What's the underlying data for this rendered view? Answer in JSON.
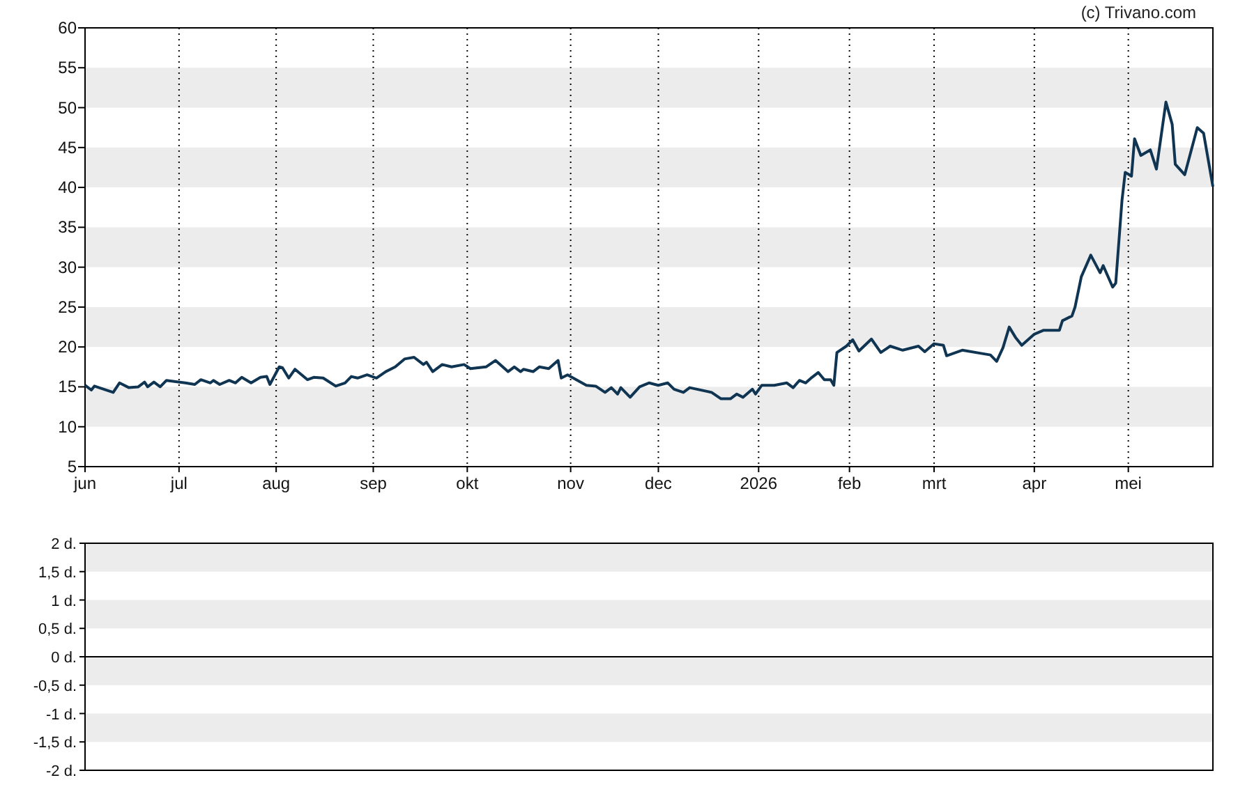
{
  "credit": "(c) Trivano.com",
  "price_chart": {
    "chart_data": {
      "type": "line",
      "ylim": [
        5,
        60
      ],
      "yticks": [
        5,
        10,
        15,
        20,
        25,
        30,
        35,
        40,
        45,
        50,
        55,
        60
      ],
      "categories": [
        "jun",
        null,
        null,
        null,
        null,
        null,
        null,
        null,
        null,
        null,
        null,
        null,
        null,
        null,
        null,
        null,
        null,
        null,
        null,
        null,
        null,
        null,
        null,
        null,
        null,
        null,
        null,
        null,
        null,
        null,
        "jul",
        null,
        null,
        null,
        null,
        null,
        null,
        null,
        null,
        null,
        null,
        null,
        null,
        null,
        null,
        null,
        null,
        null,
        null,
        null,
        null,
        null,
        null,
        null,
        null,
        null,
        null,
        null,
        null,
        null,
        null,
        "aug",
        null,
        null,
        null,
        null,
        null,
        null,
        null,
        null,
        null,
        null,
        null,
        null,
        null,
        null,
        null,
        null,
        null,
        null,
        null,
        null,
        null,
        null,
        null,
        null,
        null,
        null,
        null,
        null,
        null,
        null,
        "sep",
        null,
        null,
        null,
        null,
        null,
        null,
        null,
        null,
        null,
        null,
        null,
        null,
        null,
        null,
        null,
        null,
        null,
        null,
        null,
        null,
        null,
        null,
        null,
        null,
        null,
        null,
        null,
        null,
        null,
        "okt",
        null,
        null,
        null,
        null,
        null,
        null,
        null,
        null,
        null,
        null,
        null,
        null,
        null,
        null,
        null,
        null,
        null,
        null,
        null,
        null,
        null,
        null,
        null,
        null,
        null,
        null,
        null,
        null,
        null,
        null,
        null,
        null,
        "nov",
        null,
        null,
        null,
        null,
        null,
        null,
        null,
        null,
        null,
        null,
        null,
        null,
        null,
        null,
        null,
        null,
        null,
        null,
        null,
        null,
        null,
        null,
        null,
        null,
        null,
        null,
        null,
        "dec",
        null,
        null,
        null,
        null,
        null,
        null,
        null,
        null,
        null,
        null,
        null,
        null,
        null,
        null,
        null,
        null,
        null,
        null,
        null,
        null,
        null,
        null,
        null,
        null,
        null,
        null,
        null,
        null,
        null,
        null,
        null,
        "2026",
        null,
        null,
        null,
        null,
        null,
        null,
        null,
        null,
        null,
        null,
        null,
        null,
        null,
        null,
        null,
        null,
        null,
        null,
        null,
        null,
        null,
        null,
        null,
        null,
        null,
        null,
        null,
        null,
        "feb",
        null,
        null,
        null,
        null,
        null,
        null,
        null,
        null,
        null,
        null,
        null,
        null,
        null,
        null,
        null,
        null,
        null,
        null,
        null,
        null,
        null,
        null,
        null,
        null,
        null,
        null,
        "mrt",
        null,
        null,
        null,
        null,
        null,
        null,
        null,
        null,
        null,
        null,
        null,
        null,
        null,
        null,
        null,
        null,
        null,
        null,
        null,
        null,
        null,
        null,
        null,
        null,
        null,
        null,
        null,
        null,
        null,
        null,
        null,
        "apr",
        null,
        null,
        null,
        null,
        null,
        null,
        null,
        null,
        null,
        null,
        null,
        null,
        null,
        null,
        null,
        null,
        null,
        null,
        null,
        null,
        null,
        null,
        null,
        null,
        null,
        null,
        null,
        null,
        null,
        "mei",
        null,
        null,
        null,
        null,
        null,
        null,
        null,
        null,
        null,
        null,
        null,
        null,
        null,
        null,
        null,
        null,
        null,
        null,
        null,
        null,
        null,
        null,
        null,
        null,
        null,
        null,
        null
      ],
      "series": [
        {
          "color": "#0f3553",
          "values": [
            15.2,
            null,
            14.6,
            15.1,
            null,
            null,
            null,
            null,
            null,
            14.3,
            null,
            15.5,
            null,
            null,
            14.9,
            null,
            null,
            15.0,
            null,
            15.6,
            15.0,
            null,
            15.6,
            null,
            15.0,
            null,
            15.8,
            null,
            null,
            null,
            null,
            null,
            15.5,
            null,
            null,
            15.3,
            null,
            15.9,
            null,
            null,
            15.5,
            15.8,
            null,
            15.3,
            null,
            null,
            15.8,
            null,
            15.5,
            null,
            16.2,
            null,
            null,
            15.5,
            null,
            null,
            16.2,
            null,
            16.3,
            15.3,
            null,
            null,
            17.5,
            17.4,
            null,
            16.1,
            null,
            17.2,
            null,
            null,
            null,
            15.9,
            null,
            16.2,
            null,
            null,
            16.1,
            null,
            null,
            null,
            15.1,
            null,
            null,
            15.5,
            null,
            16.3,
            null,
            16.1,
            null,
            null,
            16.5,
            null,
            null,
            16.1,
            null,
            null,
            16.9,
            null,
            null,
            17.5,
            null,
            null,
            18.5,
            null,
            null,
            18.7,
            null,
            null,
            17.8,
            18.1,
            null,
            16.9,
            null,
            null,
            17.8,
            null,
            null,
            17.5,
            null,
            null,
            null,
            17.8,
            null,
            17.3,
            null,
            null,
            null,
            null,
            17.5,
            null,
            null,
            18.3,
            null,
            null,
            null,
            16.9,
            null,
            17.5,
            null,
            16.9,
            17.2,
            null,
            null,
            16.9,
            null,
            17.5,
            null,
            null,
            17.3,
            null,
            null,
            18.3,
            16.1,
            null,
            16.5,
            null,
            null,
            null,
            null,
            null,
            15.2,
            null,
            null,
            15.1,
            null,
            null,
            14.3,
            null,
            14.9,
            null,
            14.1,
            14.9,
            null,
            14.1,
            13.7,
            null,
            null,
            15.0,
            null,
            null,
            15.5,
            null,
            null,
            15.2,
            null,
            null,
            15.5,
            null,
            14.7,
            null,
            null,
            14.3,
            null,
            14.9,
            null,
            null,
            null,
            null,
            null,
            null,
            14.3,
            null,
            null,
            13.5,
            null,
            null,
            13.5,
            null,
            14.1,
            null,
            13.7,
            null,
            null,
            14.7,
            14.1,
            null,
            15.2,
            null,
            null,
            null,
            15.2,
            null,
            null,
            null,
            15.5,
            null,
            14.9,
            null,
            15.8,
            null,
            15.5,
            null,
            16.2,
            null,
            16.8,
            null,
            15.9,
            null,
            15.9,
            15.2,
            19.3,
            null,
            null,
            20.1,
            null,
            20.9,
            null,
            19.5,
            null,
            null,
            null,
            21.0,
            null,
            null,
            19.3,
            null,
            null,
            20.1,
            null,
            null,
            null,
            19.6,
            null,
            null,
            null,
            null,
            20.1,
            null,
            19.4,
            null,
            null,
            20.4,
            null,
            null,
            20.2,
            18.9,
            null,
            null,
            null,
            null,
            19.6,
            null,
            null,
            null,
            null,
            null,
            19.2,
            null,
            null,
            19.0,
            null,
            18.2,
            null,
            19.9,
            null,
            22.5,
            null,
            21.2,
            null,
            20.2,
            null,
            null,
            null,
            21.6,
            null,
            null,
            22.1,
            null,
            null,
            null,
            null,
            22.1,
            23.3,
            null,
            null,
            23.9,
            25.0,
            null,
            28.8,
            null,
            null,
            31.5,
            null,
            null,
            29.3,
            30.2,
            null,
            null,
            27.5,
            28.0,
            null,
            38.4,
            41.9,
            null,
            41.4,
            46.1,
            null,
            44.0,
            null,
            null,
            44.7,
            null,
            42.3,
            null,
            null,
            50.7,
            null,
            47.9,
            42.9,
            null,
            null,
            41.6,
            null,
            null,
            null,
            47.5,
            null,
            46.8,
            null,
            null,
            40.1
          ]
        }
      ]
    }
  },
  "volume_panel": {
    "yticks": [
      "2 d.",
      "1,5 d.",
      "1 d.",
      "0,5 d.",
      "0 d.",
      "-0,5 d.",
      "-1 d.",
      "-1,5 d.",
      "-2 d."
    ]
  }
}
